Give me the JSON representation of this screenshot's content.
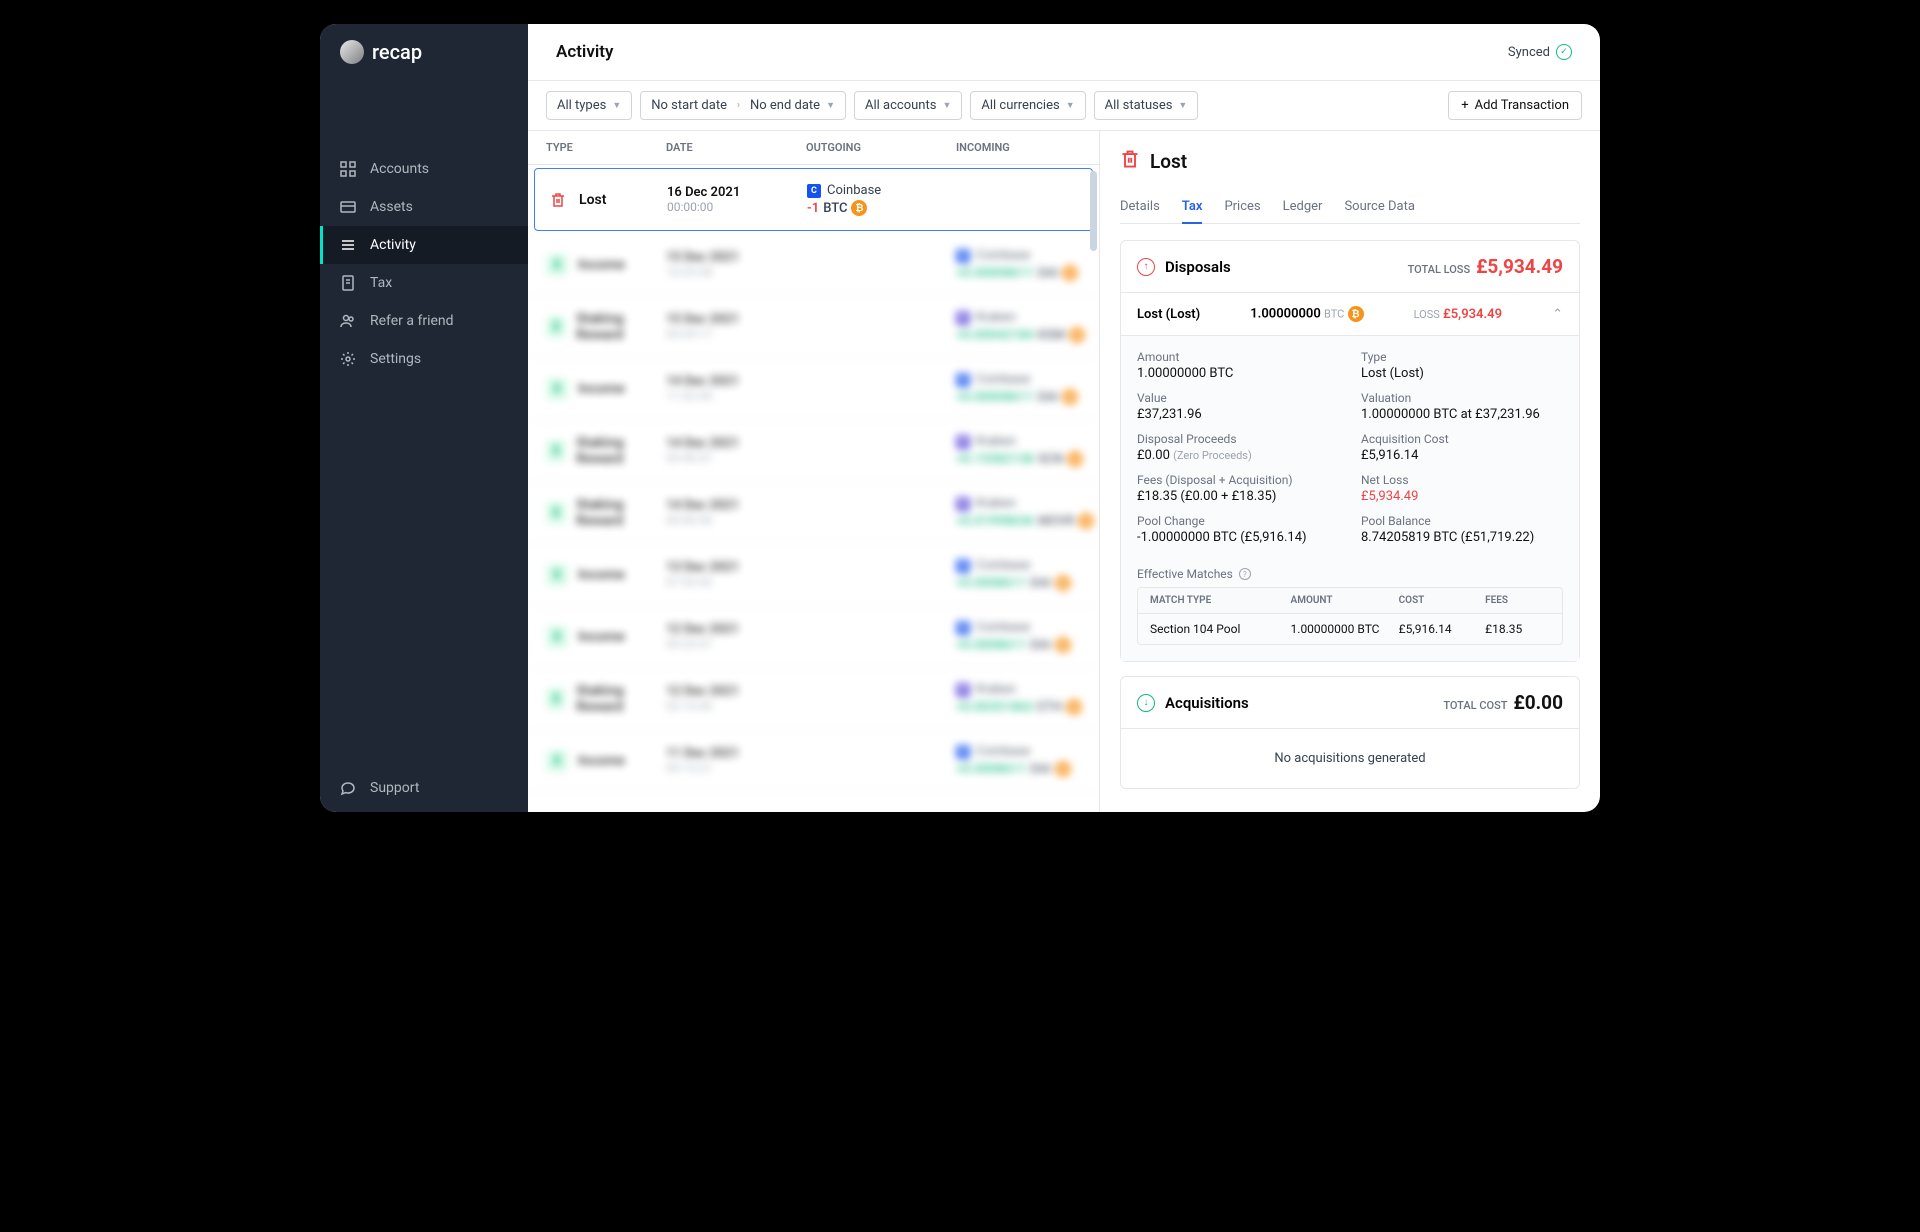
{
  "brand": "recap",
  "header": {
    "title": "Activity",
    "synced": "Synced"
  },
  "nav": [
    {
      "key": "accounts",
      "label": "Accounts"
    },
    {
      "key": "assets",
      "label": "Assets"
    },
    {
      "key": "activity",
      "label": "Activity"
    },
    {
      "key": "tax",
      "label": "Tax"
    },
    {
      "key": "refer",
      "label": "Refer a friend"
    },
    {
      "key": "settings",
      "label": "Settings"
    }
  ],
  "support": "Support",
  "filters": {
    "types": "All types",
    "startDate": "No start date",
    "endDate": "No end date",
    "accounts": "All accounts",
    "currencies": "All currencies",
    "statuses": "All statuses",
    "add": "Add Transaction"
  },
  "columns": {
    "type": "TYPE",
    "date": "DATE",
    "outgoing": "OUTGOING",
    "incoming": "INCOMING"
  },
  "rows": {
    "lost": {
      "type": "Lost",
      "date": "16 Dec 2021",
      "time": "00:00:00",
      "exchange": "Coinbase",
      "amount": "-1",
      "coin": "BTC"
    },
    "blur": [
      {
        "type": "Income",
        "date": "15 Dec 2021",
        "time": "10:29:38",
        "exchange": "Coinbase",
        "amount": "+0.00008611",
        "c": "DAI"
      },
      {
        "type": "Staking Reward",
        "date": "15 Dec 2021",
        "time": "04:39:17",
        "exchange": "Kraken",
        "amount": "+0.00042184",
        "c": "KSM"
      },
      {
        "type": "Income",
        "date": "14 Dec 2021",
        "time": "11:52:45",
        "exchange": "Coinbase",
        "amount": "+0.00008611",
        "c": "DAI"
      },
      {
        "type": "Staking Reward",
        "date": "14 Dec 2021",
        "time": "09:40:37",
        "exchange": "Kraken",
        "amount": "+0.15582138",
        "c": "SCN"
      },
      {
        "type": "Staking Reward",
        "date": "14 Dec 2021",
        "time": "00:06:56",
        "exchange": "Kraken",
        "amount": "+0.01998636",
        "c": "MOVR"
      },
      {
        "type": "Income",
        "date": "13 Dec 2021",
        "time": "07:53:42",
        "exchange": "Coinbase",
        "amount": "+0.0008611",
        "c": "DAI"
      },
      {
        "type": "Income",
        "date": "12 Dec 2021",
        "time": "09:25:57",
        "exchange": "Coinbase",
        "amount": "+0.0008611",
        "c": "DAI"
      },
      {
        "type": "Staking Reward",
        "date": "12 Dec 2021",
        "time": "02:15:46",
        "exchange": "Kraken",
        "amount": "+0.00351863",
        "c": "ETH"
      },
      {
        "type": "Income",
        "date": "11 Dec 2021",
        "time": "09:13:21",
        "exchange": "Coinbase",
        "amount": "+0.0008611",
        "c": "DAI"
      }
    ]
  },
  "detail": {
    "title": "Lost",
    "tabs": [
      "Details",
      "Tax",
      "Prices",
      "Ledger",
      "Source Data"
    ],
    "disposals": {
      "title": "Disposals",
      "totalLabel": "TOTAL LOSS",
      "total": "£5,934.49",
      "line": {
        "name": "Lost (Lost)",
        "qty": "1.00000000",
        "coin": "BTC",
        "lossLabel": "LOSS",
        "loss": "£5,934.49"
      },
      "fields": {
        "amount": {
          "l": "Amount",
          "v": "1.00000000 BTC"
        },
        "type": {
          "l": "Type",
          "v": "Lost (Lost)"
        },
        "value": {
          "l": "Value",
          "v": "£37,231.96"
        },
        "valuation": {
          "l": "Valuation",
          "v": "1.00000000 BTC at £37,231.96"
        },
        "proceeds": {
          "l": "Disposal Proceeds",
          "v": "£0.00",
          "s": "(Zero Proceeds)"
        },
        "acqCost": {
          "l": "Acquisition Cost",
          "v": "£5,916.14"
        },
        "fees": {
          "l": "Fees (Disposal + Acquisition)",
          "v": "£18.35 (£0.00 + £18.35)"
        },
        "netLoss": {
          "l": "Net Loss",
          "v": "£5,934.49"
        },
        "poolChange": {
          "l": "Pool Change",
          "v": "-1.00000000 BTC (£5,916.14)"
        },
        "poolBalance": {
          "l": "Pool Balance",
          "v": "8.74205819 BTC (£51,719.22)"
        }
      },
      "matchesLabel": "Effective Matches",
      "matchCols": {
        "mt": "MATCH TYPE",
        "am": "AMOUNT",
        "co": "COST",
        "fe": "FEES"
      },
      "matchRow": {
        "mt": "Section 104 Pool",
        "am": "1.00000000 BTC",
        "co": "£5,916.14",
        "fe": "£18.35"
      }
    },
    "acquisitions": {
      "title": "Acquisitions",
      "totalLabel": "TOTAL COST",
      "total": "£0.00",
      "msg": "No acquisitions generated"
    }
  }
}
